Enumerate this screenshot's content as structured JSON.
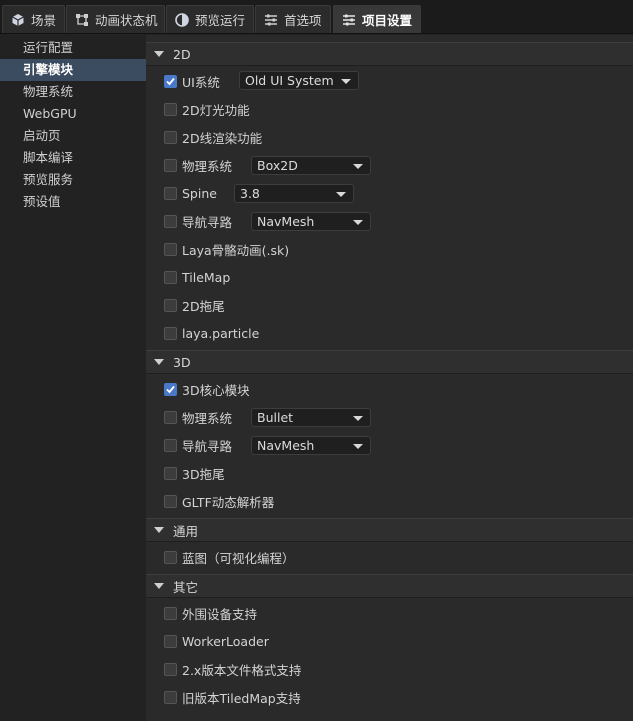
{
  "tabs": [
    {
      "label": "场景",
      "icon": "cube-icon"
    },
    {
      "label": "动画状态机",
      "icon": "animator-icon"
    },
    {
      "label": "预览运行",
      "icon": "preview-icon"
    },
    {
      "label": "首选项",
      "icon": "sliders-icon"
    },
    {
      "label": "项目设置",
      "icon": "sliders-icon",
      "active": true
    }
  ],
  "sidebar": {
    "items": [
      "运行配置",
      "引擎模块",
      "物理系统",
      "WebGPU",
      "启动页",
      "脚本编译",
      "预览服务",
      "预设值"
    ],
    "active_index": 1
  },
  "sections": {
    "s2d": {
      "title": "2D",
      "ui": {
        "label": "UI系统",
        "checked": true,
        "select": "Old UI System"
      },
      "light": {
        "label": "2D灯光功能",
        "checked": false
      },
      "line": {
        "label": "2D线渲染功能",
        "checked": false
      },
      "physics": {
        "label": "物理系统",
        "checked": false,
        "select": "Box2D"
      },
      "spine": {
        "label": "Spine",
        "checked": false,
        "select": "3.8"
      },
      "nav": {
        "label": "导航寻路",
        "checked": false,
        "select": "NavMesh"
      },
      "skeleton": {
        "label": "Laya骨骼动画(.sk)",
        "checked": false
      },
      "tilemap": {
        "label": "TileMap",
        "checked": false
      },
      "trail": {
        "label": "2D拖尾",
        "checked": false
      },
      "particle": {
        "label": "laya.particle",
        "checked": false
      }
    },
    "s3d": {
      "title": "3D",
      "core": {
        "label": "3D核心模块",
        "checked": true
      },
      "physics": {
        "label": "物理系统",
        "checked": false,
        "select": "Bullet"
      },
      "nav": {
        "label": "导航寻路",
        "checked": false,
        "select": "NavMesh"
      },
      "trail": {
        "label": "3D拖尾",
        "checked": false
      },
      "gltf": {
        "label": "GLTF动态解析器",
        "checked": false
      }
    },
    "common": {
      "title": "通用",
      "blueprint": {
        "label": "蓝图（可视化编程）",
        "checked": false
      }
    },
    "other": {
      "title": "其它",
      "device": {
        "label": "外围设备支持",
        "checked": false
      },
      "worker": {
        "label": "WorkerLoader",
        "checked": false
      },
      "format2x": {
        "label": "2.x版本文件格式支持",
        "checked": false
      },
      "tiledmap": {
        "label": "旧版本TiledMap支持",
        "checked": false
      }
    }
  },
  "colors": {
    "accent": "#4a78c8",
    "sidebar_active": "#3b4b60"
  }
}
